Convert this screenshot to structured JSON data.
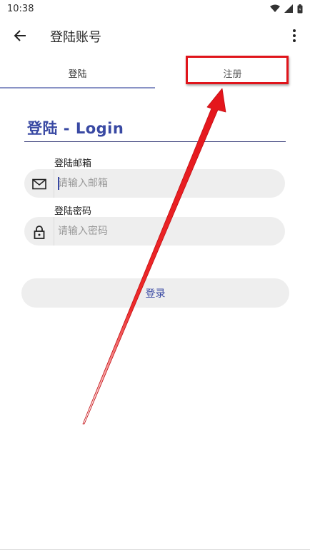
{
  "status_bar": {
    "time": "10:38"
  },
  "app_bar": {
    "title": "登陆账号"
  },
  "tabs": [
    {
      "label": "登陆",
      "active": true
    },
    {
      "label": "注册",
      "active": false
    }
  ],
  "form": {
    "title": "登陆 - Login",
    "email": {
      "label": "登陆邮箱",
      "placeholder": "请输入邮箱",
      "value": ""
    },
    "password": {
      "label": "登陆密码",
      "placeholder": "请输入密码",
      "value": ""
    },
    "submit_label": "登录"
  },
  "colors": {
    "accent": "#3949a3",
    "annotation": "#e0141b",
    "field_bg": "#eeeeee"
  },
  "icons": [
    "back-arrow-icon",
    "more-vert-icon",
    "wifi-icon",
    "signal-icon",
    "battery-icon",
    "mail-icon",
    "lock-icon"
  ]
}
